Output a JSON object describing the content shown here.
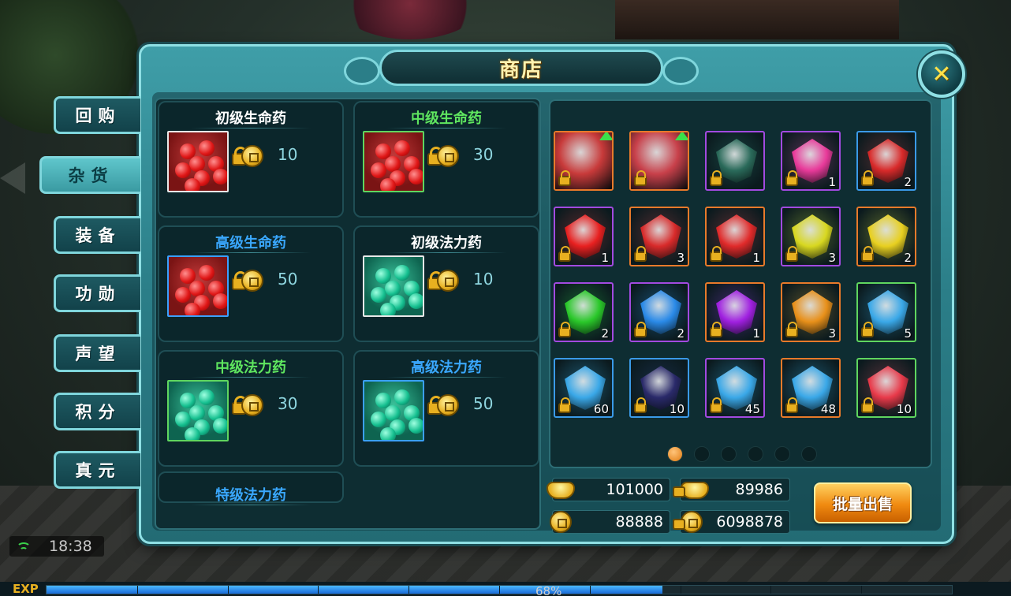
{
  "shop": {
    "title": "商店",
    "close_icon": "close-x-icon"
  },
  "tabs": [
    {
      "label": "回购",
      "active": false
    },
    {
      "label": "杂货",
      "active": true
    },
    {
      "label": "装备",
      "active": false
    },
    {
      "label": "功勋",
      "active": false
    },
    {
      "label": "声望",
      "active": false
    },
    {
      "label": "积分",
      "active": false
    },
    {
      "label": "真元",
      "active": false
    }
  ],
  "products": [
    {
      "name": "初级生命药",
      "name_color": "#ffffff",
      "price": "10",
      "type": "health",
      "icon_border": "#e8e8e8"
    },
    {
      "name": "中级生命药",
      "name_color": "#5fe65f",
      "price": "30",
      "type": "health",
      "icon_border": "#5fd65f"
    },
    {
      "name": "高级生命药",
      "name_color": "#3aa8ff",
      "price": "50",
      "type": "health",
      "icon_border": "#3aa0ff"
    },
    {
      "name": "初级法力药",
      "name_color": "#ffffff",
      "price": "10",
      "type": "mana",
      "icon_border": "#e8e8e8"
    },
    {
      "name": "中级法力药",
      "name_color": "#5fe65f",
      "price": "30",
      "type": "mana",
      "icon_border": "#5fd65f"
    },
    {
      "name": "高级法力药",
      "name_color": "#3aa8ff",
      "price": "50",
      "type": "mana",
      "icon_border": "#3aa0ff"
    }
  ],
  "partial_product_name": "特级法力药",
  "inventory": [
    {
      "item": "ring",
      "qty": "",
      "border": "#e87a2a",
      "color": "#c83a3a",
      "upgrade": true
    },
    {
      "item": "glove",
      "qty": "",
      "border": "#e87a2a",
      "color": "#c8404a",
      "upgrade": true
    },
    {
      "item": "sword",
      "qty": "",
      "border": "#a24ae0",
      "color": "#2a6a5a",
      "upgrade": false
    },
    {
      "item": "pink-gem",
      "qty": "1",
      "border": "#a24ae0",
      "color": "#e83a9a",
      "upgrade": false
    },
    {
      "item": "red-gem",
      "qty": "2",
      "border": "#3a9ae8",
      "color": "#d82a2a",
      "upgrade": false
    },
    {
      "item": "red-gem",
      "qty": "1",
      "border": "#a24ae0",
      "color": "#e82020",
      "upgrade": false
    },
    {
      "item": "red-gem",
      "qty": "3",
      "border": "#e87a2a",
      "color": "#d82a2a",
      "upgrade": false
    },
    {
      "item": "red-gem",
      "qty": "1",
      "border": "#e87a2a",
      "color": "#e02a2a",
      "upgrade": false
    },
    {
      "item": "yellow-gem",
      "qty": "3",
      "border": "#a24ae0",
      "color": "#d8d820",
      "upgrade": false
    },
    {
      "item": "yellow-gem",
      "qty": "2",
      "border": "#e87a2a",
      "color": "#e8d020",
      "upgrade": false
    },
    {
      "item": "green-gem",
      "qty": "2",
      "border": "#a24ae0",
      "color": "#2ac82a",
      "upgrade": false
    },
    {
      "item": "blue-gem",
      "qty": "2",
      "border": "#a24ae0",
      "color": "#2a8ae8",
      "upgrade": false
    },
    {
      "item": "purple-gem",
      "qty": "1",
      "border": "#e87a2a",
      "color": "#a020e0",
      "upgrade": false
    },
    {
      "item": "orange-gem",
      "qty": "3",
      "border": "#e87a2a",
      "color": "#e8901a",
      "upgrade": false
    },
    {
      "item": "blue-crystal",
      "qty": "5",
      "border": "#5fd65f",
      "color": "#3aa8e8",
      "upgrade": false
    },
    {
      "item": "blue-crystal",
      "qty": "60",
      "border": "#3a9ae8",
      "color": "#3aa8e8",
      "upgrade": false
    },
    {
      "item": "bottle",
      "qty": "10",
      "border": "#3a9ae8",
      "color": "#2a2a6a",
      "upgrade": false
    },
    {
      "item": "blue-crystal",
      "qty": "45",
      "border": "#a24ae0",
      "color": "#3aa8e8",
      "upgrade": false
    },
    {
      "item": "blue-crystal",
      "qty": "48",
      "border": "#e87a2a",
      "color": "#3aa8e8",
      "upgrade": false
    },
    {
      "item": "red-crystal",
      "qty": "10",
      "border": "#5fd65f",
      "color": "#e83a4a",
      "upgrade": false
    }
  ],
  "pagination": {
    "total": 6,
    "current": 1
  },
  "currencies": {
    "gold_ingot": "101000",
    "bound_gold_ingot": "89986",
    "coins": "88888",
    "bound_coins": "6098878"
  },
  "sell_button": "批量出售",
  "status": {
    "time": "18:38"
  },
  "exp": {
    "label": "EXP",
    "percent_text": "68%",
    "fraction": 0.68
  }
}
